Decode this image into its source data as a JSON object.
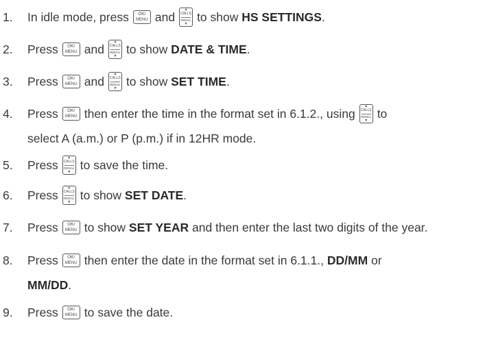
{
  "keys": {
    "ok_menu": {
      "top": "OK/",
      "bottom": "MENU",
      "icon": "ok-menu-key-icon"
    },
    "calls_redial": {
      "top": "CALLS",
      "bottom": "REDIAL",
      "up": "▲",
      "down": "▼",
      "icon": "calls-redial-key-icon"
    }
  },
  "steps": [
    {
      "num": "1.",
      "parts": [
        {
          "t": "text",
          "v": "In idle mode, press"
        },
        {
          "t": "key",
          "k": "ok_menu"
        },
        {
          "t": "text",
          "v": "and"
        },
        {
          "t": "key",
          "k": "calls_redial"
        },
        {
          "t": "text",
          "v": "to show "
        },
        {
          "t": "bold",
          "v": "HS SETTINGS"
        },
        {
          "t": "text",
          "v": "."
        }
      ]
    },
    {
      "num": "2.",
      "parts": [
        {
          "t": "text",
          "v": "Press"
        },
        {
          "t": "key",
          "k": "ok_menu"
        },
        {
          "t": "text",
          "v": "and"
        },
        {
          "t": "key",
          "k": "calls_redial"
        },
        {
          "t": "text",
          "v": "to show "
        },
        {
          "t": "bold",
          "v": "DATE & TIME"
        },
        {
          "t": "text",
          "v": "."
        }
      ]
    },
    {
      "num": "3.",
      "parts": [
        {
          "t": "text",
          "v": "Press"
        },
        {
          "t": "key",
          "k": "ok_menu"
        },
        {
          "t": "text",
          "v": "and"
        },
        {
          "t": "key",
          "k": "calls_redial"
        },
        {
          "t": "text",
          "v": "to show "
        },
        {
          "t": "bold",
          "v": "SET TIME"
        },
        {
          "t": "text",
          "v": "."
        }
      ]
    },
    {
      "num": "4.",
      "parts": [
        {
          "t": "text",
          "v": "Press"
        },
        {
          "t": "key",
          "k": "ok_menu"
        },
        {
          "t": "text",
          "v": "then enter the time in the format set in 6.1.2., using"
        },
        {
          "t": "key",
          "k": "calls_redial"
        },
        {
          "t": "text",
          "v": "to"
        }
      ]
    },
    {
      "num": "",
      "parts": [
        {
          "t": "text",
          "v": "select A (a.m.) or P (p.m.) if in 12HR mode."
        }
      ]
    },
    {
      "num": "5.",
      "parts": [
        {
          "t": "text",
          "v": "Press"
        },
        {
          "t": "key",
          "k": "calls_redial"
        },
        {
          "t": "text",
          "v": "to save the time."
        }
      ]
    },
    {
      "num": "6.",
      "parts": [
        {
          "t": "text",
          "v": "Press"
        },
        {
          "t": "key",
          "k": "calls_redial"
        },
        {
          "t": "text",
          "v": "to show "
        },
        {
          "t": "bold",
          "v": "SET DATE"
        },
        {
          "t": "text",
          "v": "."
        }
      ]
    },
    {
      "num": "7.",
      "parts": [
        {
          "t": "text",
          "v": "Press"
        },
        {
          "t": "key",
          "k": "ok_menu"
        },
        {
          "t": "text",
          "v": "to show "
        },
        {
          "t": "bold",
          "v": "SET YEAR"
        },
        {
          "t": "text",
          "v": " and then enter the last two digits of the year."
        }
      ]
    },
    {
      "num": "8.",
      "parts": [
        {
          "t": "text",
          "v": "Press"
        },
        {
          "t": "key",
          "k": "ok_menu"
        },
        {
          "t": "text",
          "v": "then enter the date in the format set in 6.1.1., "
        },
        {
          "t": "bold",
          "v": "DD/MM"
        },
        {
          "t": "text",
          "v": " or"
        }
      ]
    },
    {
      "num": "",
      "parts": [
        {
          "t": "bold",
          "v": "MM/DD"
        },
        {
          "t": "text",
          "v": "."
        }
      ]
    },
    {
      "num": "9.",
      "parts": [
        {
          "t": "text",
          "v": "Press"
        },
        {
          "t": "key",
          "k": "ok_menu"
        },
        {
          "t": "text",
          "v": "to save the date."
        }
      ]
    }
  ]
}
